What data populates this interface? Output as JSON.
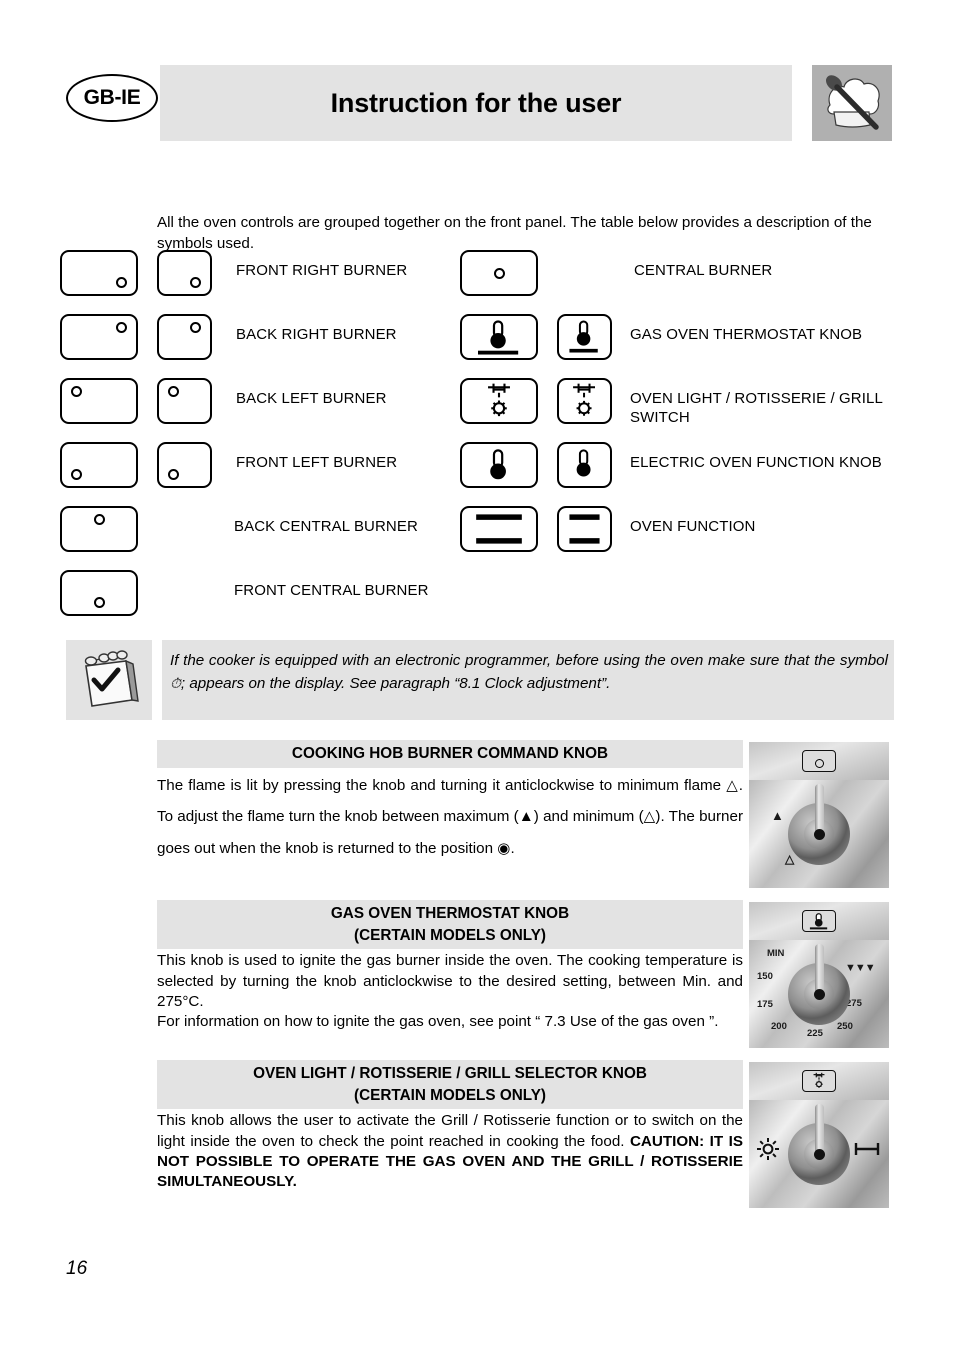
{
  "header": {
    "locale_badge": "GB-IE",
    "title": "Instruction for the user",
    "logo_icon": "chef-hat-spoon-icon"
  },
  "intro": "All the oven controls are grouped together on the front panel. The table below provides a description of the symbols used.",
  "symbol_table": {
    "left_column": [
      {
        "label": "FRONT RIGHT BURNER",
        "icon": "burner-front-right-icon",
        "dot": "br",
        "has_square": true
      },
      {
        "label": "BACK RIGHT BURNER",
        "icon": "burner-back-right-icon",
        "dot": "tr",
        "has_square": true
      },
      {
        "label": "BACK LEFT BURNER",
        "icon": "burner-back-left-icon",
        "dot": "tl",
        "has_square": true
      },
      {
        "label": "FRONT LEFT BURNER",
        "icon": "burner-front-left-icon",
        "dot": "bl",
        "has_square": true
      },
      {
        "label": "BACK CENTRAL BURNER",
        "icon": "burner-back-central-icon",
        "dot": "tc",
        "has_square": false
      },
      {
        "label": "FRONT CENTRAL BURNER",
        "icon": "burner-front-central-icon",
        "dot": "bc",
        "has_square": false
      }
    ],
    "right_column": [
      {
        "label": "CENTRAL BURNER",
        "icon": "burner-central-icon",
        "has_square": false
      },
      {
        "label": "GAS OVEN THERMOSTAT KNOB",
        "icon": "thermometer-base-icon",
        "has_square": true
      },
      {
        "label": "OVEN LIGHT / ROTISSERIE / GRILL SWITCH",
        "icon": "light-rotisserie-icon",
        "has_square": true
      },
      {
        "label": "ELECTRIC OVEN FUNCTION KNOB",
        "icon": "thermometer-icon",
        "has_square": true
      },
      {
        "label": "OVEN FUNCTION",
        "icon": "oven-function-bars-icon",
        "has_square": true
      }
    ]
  },
  "note": {
    "icon": "notepad-pencil-check-icon",
    "text_before": "If the cooker is equipped with an electronic programmer, before using the oven make sure that the symbol ",
    "symbol": "clock-pot-symbol",
    "text_after": "; appears on the display. See paragraph “8.1 Clock adjustment”."
  },
  "sections": [
    {
      "heading": "COOKING HOB BURNER COMMAND KNOB",
      "subheading": "",
      "body_segments": [
        "The flame is lit by pressing the knob and turning it anticlockwise to minimum flame ",
        ". To adjust the flame turn the knob between maximum (",
        ") and minimum (",
        "). The burner goes out when the knob is returned to the position ",
        "."
      ],
      "panel": {
        "badge_icon": "burner-front-central-icon",
        "marks": [
          {
            "text": "max-flame-icon",
            "role": "max"
          },
          {
            "text": "min-flame-icon",
            "role": "min"
          }
        ]
      }
    },
    {
      "heading": "GAS OVEN THERMOSTAT KNOB",
      "subheading": "(CERTAIN MODELS ONLY)",
      "body": "This knob is used to ignite the gas burner inside the oven. The cooking temperature is selected by turning the knob anticlockwise to the desired setting, between Min. and 275°C.\nFor information on how to ignite the gas oven, see point “ 7.3 Use of the gas oven ”.",
      "panel": {
        "badge_icon": "thermometer-base-icon",
        "dial_labels": [
          "MIN",
          "150",
          "175",
          "200",
          "225",
          "250",
          "275"
        ],
        "extra_icon": "triple-flame-grill-icon"
      }
    },
    {
      "heading": "OVEN LIGHT / ROTISSERIE / GRILL SELECTOR KNOB",
      "subheading": "(CERTAIN MODELS ONLY)",
      "body_normal": "This knob allows the user to activate the Grill / Rotisserie function or to switch on the light inside the oven to check the point reached in cooking the food.",
      "body_bold": "CAUTION: IT IS NOT POSSIBLE TO OPERATE THE GAS OVEN AND THE GRILL / ROTISSERIE SIMULTANEOUSLY.",
      "panel": {
        "badge_icon": "light-rotisserie-icon",
        "left_icon": "oven-light-sun-icon",
        "right_icon": "rotisserie-spit-icon"
      }
    }
  ],
  "page_number": "16",
  "colors": {
    "band_gray": "#e3e3e3",
    "logo_gray": "#b0b0b0",
    "ink": "#000000"
  }
}
